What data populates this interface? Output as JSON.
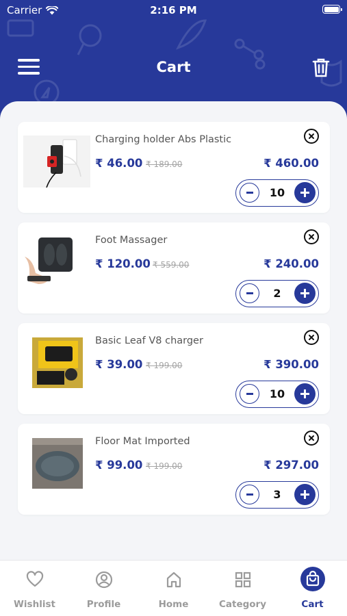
{
  "status_bar": {
    "carrier": "Carrier",
    "time": "2:16 PM"
  },
  "header": {
    "title": "Cart"
  },
  "cart": {
    "items": [
      {
        "name": "Charging holder Abs Plastic",
        "price": "₹ 46.00",
        "mrp": "₹ 189.00",
        "total": "₹ 460.00",
        "qty": "10"
      },
      {
        "name": "Foot Massager",
        "price": "₹ 120.00",
        "mrp": "₹ 559.00",
        "total": "₹ 240.00",
        "qty": "2"
      },
      {
        "name": "Basic Leaf V8 charger",
        "price": "₹ 39.00",
        "mrp": "₹ 199.00",
        "total": "₹ 390.00",
        "qty": "10"
      },
      {
        "name": "Floor Mat Imported",
        "price": "₹ 99.00",
        "mrp": "₹ 199.00",
        "total": "₹ 297.00",
        "qty": "3"
      }
    ]
  },
  "bottom_nav": {
    "items": [
      {
        "label": "Wishlist",
        "icon": "heart-icon"
      },
      {
        "label": "Profile",
        "icon": "user-circle-icon"
      },
      {
        "label": "Home",
        "icon": "home-icon"
      },
      {
        "label": "Category",
        "icon": "grid-icon"
      },
      {
        "label": "Cart",
        "icon": "shopping-bag-icon",
        "active": true
      }
    ]
  },
  "colors": {
    "primary": "#27399a",
    "background": "#f4f5f8",
    "inactive": "#9b9b9b"
  }
}
